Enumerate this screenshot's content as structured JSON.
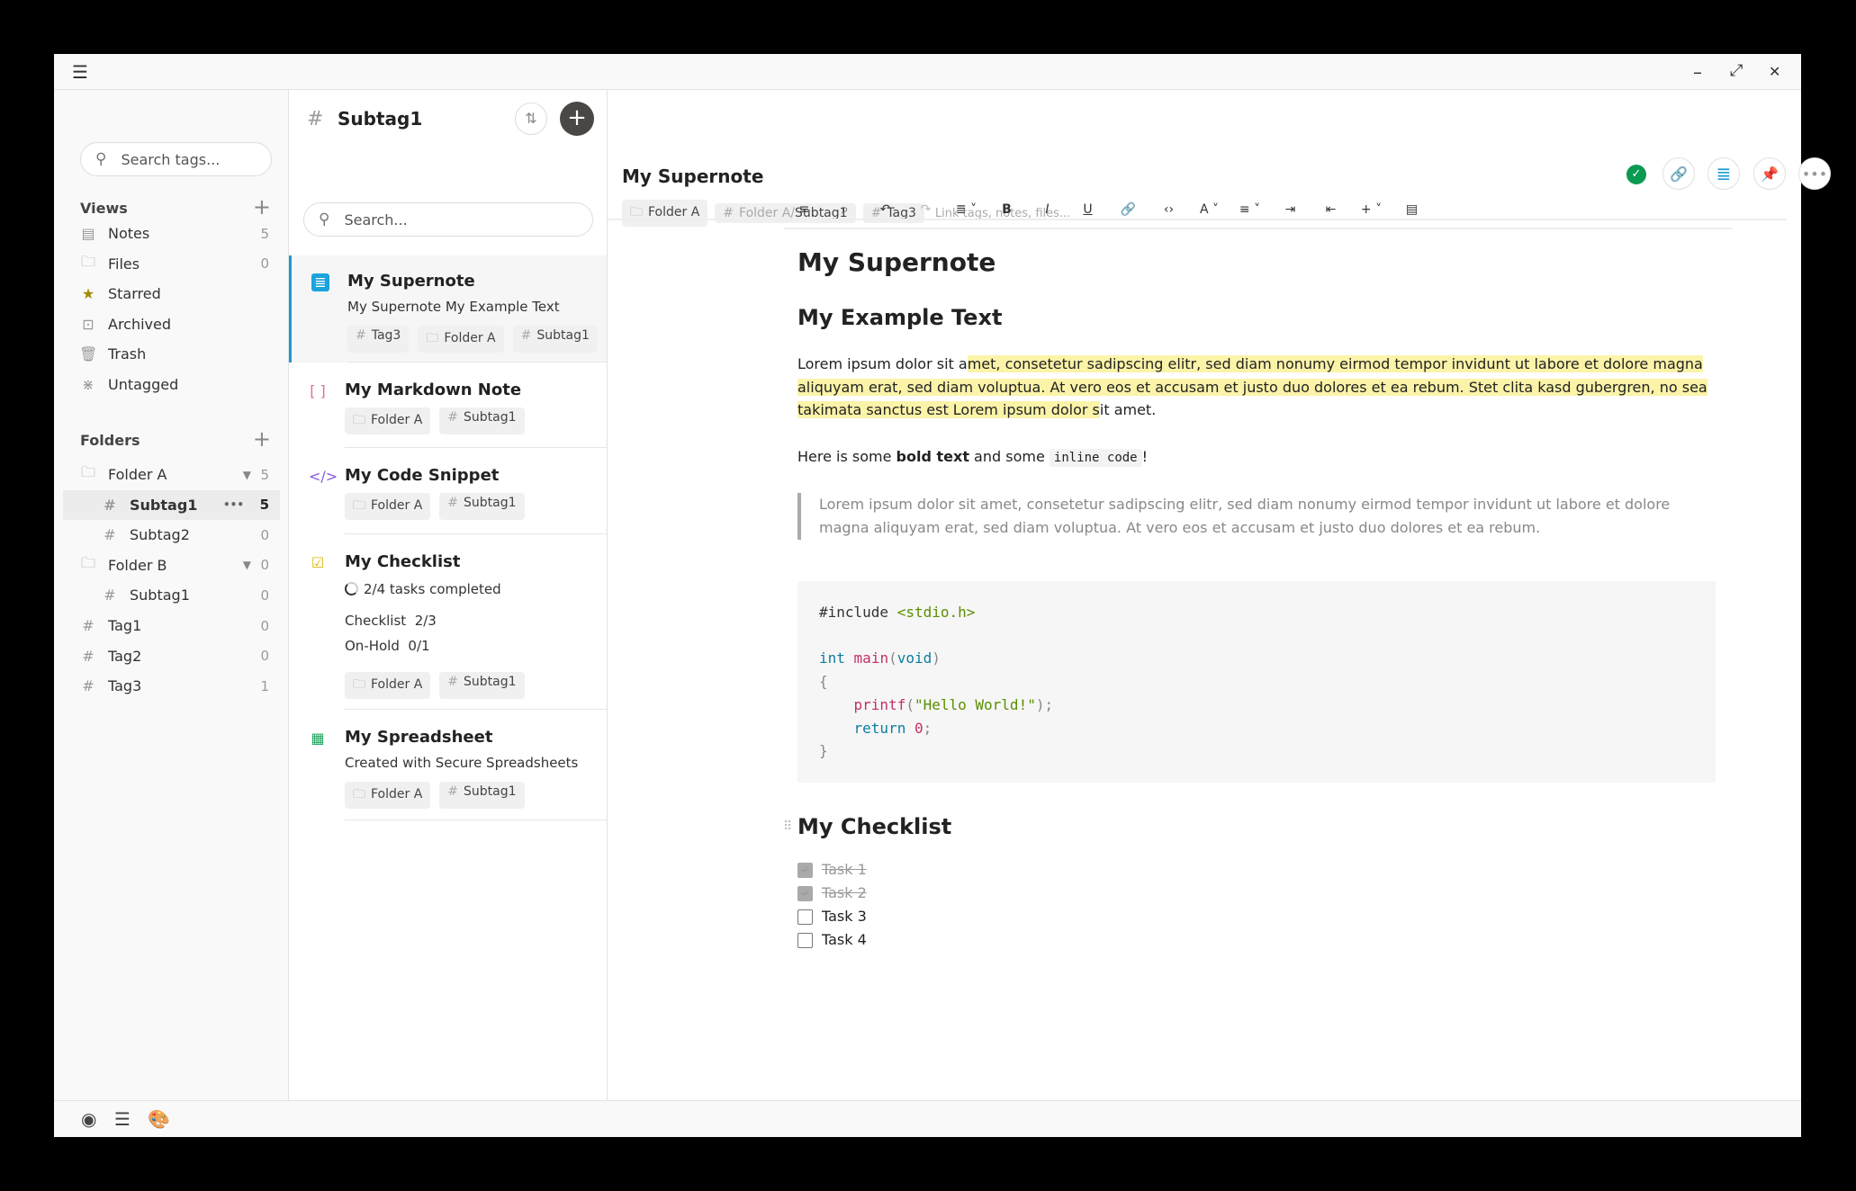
{
  "titlebar": {
    "menu_icon": "hamburger-icon",
    "minimize": "–",
    "maximize": "⤢",
    "close": "✕"
  },
  "sidebar": {
    "search_placeholder": "Search tags...",
    "views_label": "Views",
    "views": [
      {
        "label": "Notes",
        "count": "5",
        "icon": "▤"
      },
      {
        "label": "Files",
        "count": "0",
        "icon": "🗀"
      },
      {
        "label": "Starred",
        "count": "",
        "icon": "★"
      },
      {
        "label": "Archived",
        "count": "",
        "icon": "⊡"
      },
      {
        "label": "Trash",
        "count": "",
        "icon": "🗑"
      },
      {
        "label": "Untagged",
        "count": "",
        "icon": "⋇"
      }
    ],
    "folders_label": "Folders",
    "folders": [
      {
        "label": "Folder A",
        "count": "5"
      },
      {
        "label": "Subtag1",
        "count": "5",
        "more": "•••"
      },
      {
        "label": "Subtag2",
        "count": "0"
      },
      {
        "label": "Folder B",
        "count": "0"
      },
      {
        "label": "Subtag1",
        "count": "0"
      },
      {
        "label": "Tag1",
        "count": "0"
      },
      {
        "label": "Tag2",
        "count": "0"
      },
      {
        "label": "Tag3",
        "count": "1"
      }
    ]
  },
  "list": {
    "title": "Subtag1",
    "search_placeholder": "Search...",
    "items": [
      {
        "title": "My Supernote",
        "preview": "My Supernote My Example Text",
        "chips": [
          "Tag3",
          "Folder A",
          "Subtag1"
        ]
      },
      {
        "title": "My Markdown Note",
        "chips": [
          "Folder A",
          "Subtag1"
        ]
      },
      {
        "title": "My Code Snippet",
        "chips": [
          "Folder A",
          "Subtag1"
        ]
      },
      {
        "title": "My Checklist",
        "progress": "2/4 tasks completed",
        "groups": [
          "Checklist  2/3",
          "On-Hold  0/1"
        ],
        "chips": [
          "Folder A",
          "Subtag1"
        ]
      },
      {
        "title": "My Spreadsheet",
        "preview": "Created with Secure Spreadsheets",
        "chips": [
          "Folder A",
          "Subtag1"
        ]
      }
    ]
  },
  "editor": {
    "title": "My Supernote",
    "tags": {
      "folder": "Folder A",
      "subtag_prefix": "Folder A/",
      "subtag": "Subtag1",
      "tag": "Tag3",
      "link_placeholder": "Link tags, notes, files..."
    },
    "toolbar": [
      "≡",
      "⌕",
      "↶",
      "↷",
      "≣ ˅",
      "B",
      "I",
      "U",
      "🔗",
      "‹›",
      "A ˅",
      "≡ ˅",
      "⇥",
      "⇤",
      "+ ˅",
      "▤"
    ],
    "h1": "My Supernote",
    "h2": "My Example Text",
    "p1_a": "Lorem ipsum dolor sit a",
    "p1_hl": "met, consetetur sadipscing elitr, sed diam nonumy eirmod tempor invidunt ut labore et dolore magna aliquyam erat, sed diam voluptua. At vero eos et accusam et justo duo dolores et ea rebum. Stet clita kasd gubergren, no sea takimata sanctus est Lorem ipsum dolor s",
    "p1_b": "it amet.",
    "p2_a": "Here is some ",
    "p2_bold": "bold text",
    "p2_b": " and some ",
    "p2_code": "inline code",
    "p2_c": "!",
    "quote": "Lorem ipsum dolor sit amet, consetetur sadipscing elitr, sed diam nonumy eirmod tempor invidunt ut labore et dolore magna aliquyam erat, sed diam voluptua. At vero eos et accusam et justo duo dolores et ea rebum.",
    "checklist_title": "My Checklist",
    "tasks": [
      {
        "label": "Task 1",
        "done": true
      },
      {
        "label": "Task 2",
        "done": true
      },
      {
        "label": "Task 3",
        "done": false
      },
      {
        "label": "Task 4",
        "done": false
      }
    ]
  }
}
